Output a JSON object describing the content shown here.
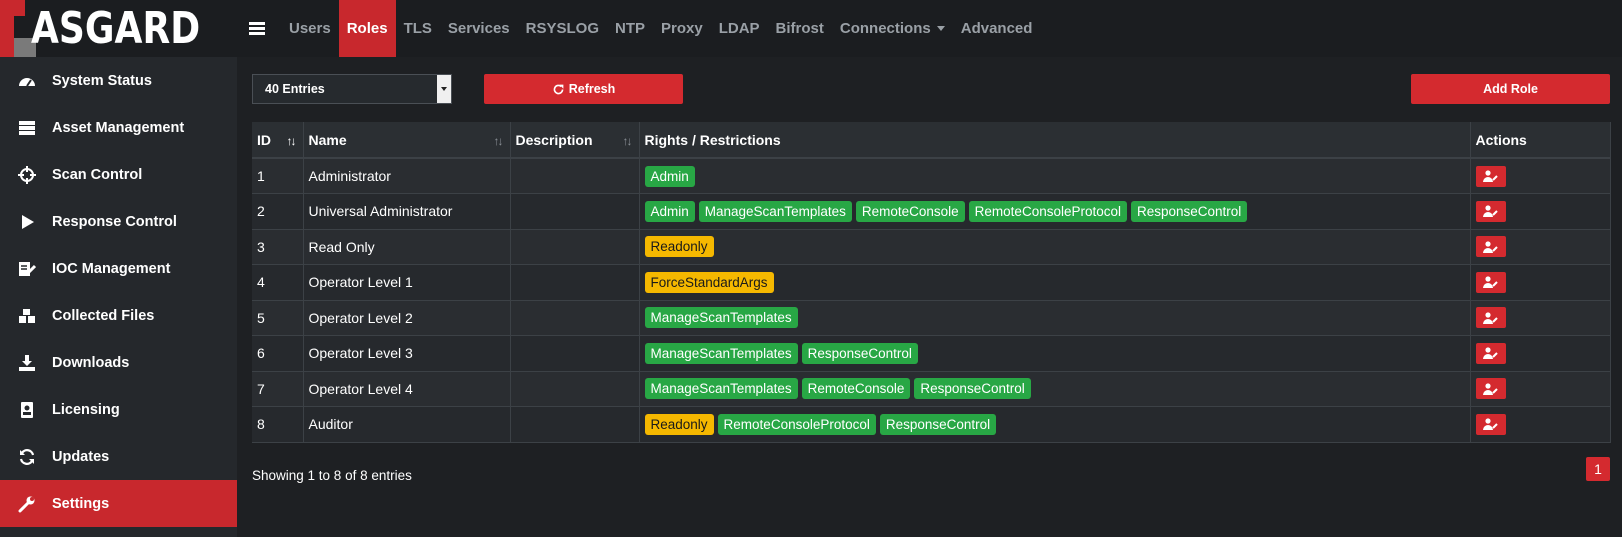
{
  "app": {
    "name": "ASGARD"
  },
  "sidebar": {
    "items": [
      {
        "label": "System Status",
        "icon": "dashboard-icon"
      },
      {
        "label": "Asset Management",
        "icon": "server-icon"
      },
      {
        "label": "Scan Control",
        "icon": "crosshair-icon"
      },
      {
        "label": "Response Control",
        "icon": "play-icon"
      },
      {
        "label": "IOC Management",
        "icon": "edit-document-icon"
      },
      {
        "label": "Collected Files",
        "icon": "boxes-icon"
      },
      {
        "label": "Downloads",
        "icon": "download-icon"
      },
      {
        "label": "Licensing",
        "icon": "id-card-icon"
      },
      {
        "label": "Updates",
        "icon": "sync-icon"
      },
      {
        "label": "Settings",
        "icon": "wrench-icon"
      }
    ],
    "active": "Settings"
  },
  "topnav": {
    "items": [
      "Users",
      "Roles",
      "TLS",
      "Services",
      "RSYSLOG",
      "NTP",
      "Proxy",
      "LDAP",
      "Bifrost",
      "Connections",
      "Advanced"
    ],
    "active": "Roles"
  },
  "controls": {
    "entries_selected": "40 Entries",
    "refresh_label": "Refresh",
    "add_role_label": "Add Role"
  },
  "table": {
    "columns": [
      "ID",
      "Name",
      "Description",
      "Rights / Restrictions",
      "Actions"
    ],
    "rows": [
      {
        "id": "1",
        "name": "Administrator",
        "description": "",
        "rights": [
          {
            "label": "Admin",
            "color": "green"
          }
        ]
      },
      {
        "id": "2",
        "name": "Universal Administrator",
        "description": "",
        "rights": [
          {
            "label": "Admin",
            "color": "green"
          },
          {
            "label": "ManageScanTemplates",
            "color": "green"
          },
          {
            "label": "RemoteConsole",
            "color": "green"
          },
          {
            "label": "RemoteConsoleProtocol",
            "color": "green"
          },
          {
            "label": "ResponseControl",
            "color": "green"
          }
        ]
      },
      {
        "id": "3",
        "name": "Read Only",
        "description": "",
        "rights": [
          {
            "label": "Readonly",
            "color": "yellow"
          }
        ]
      },
      {
        "id": "4",
        "name": "Operator Level 1",
        "description": "",
        "rights": [
          {
            "label": "ForceStandardArgs",
            "color": "yellow"
          }
        ]
      },
      {
        "id": "5",
        "name": "Operator Level 2",
        "description": "",
        "rights": [
          {
            "label": "ManageScanTemplates",
            "color": "green"
          }
        ]
      },
      {
        "id": "6",
        "name": "Operator Level 3",
        "description": "",
        "rights": [
          {
            "label": "ManageScanTemplates",
            "color": "green"
          },
          {
            "label": "ResponseControl",
            "color": "green"
          }
        ]
      },
      {
        "id": "7",
        "name": "Operator Level 4",
        "description": "",
        "rights": [
          {
            "label": "ManageScanTemplates",
            "color": "green"
          },
          {
            "label": "RemoteConsole",
            "color": "green"
          },
          {
            "label": "ResponseControl",
            "color": "green"
          }
        ]
      },
      {
        "id": "8",
        "name": "Auditor",
        "description": "",
        "rights": [
          {
            "label": "Readonly",
            "color": "yellow"
          },
          {
            "label": "RemoteConsoleProtocol",
            "color": "green"
          },
          {
            "label": "ResponseControl",
            "color": "green"
          }
        ]
      }
    ]
  },
  "footer": {
    "showing": "Showing 1 to 8 of 8 entries",
    "page": "1"
  },
  "colors": {
    "accent": "#d42a2f",
    "badge_green": "#28a745",
    "badge_yellow": "#f5b800"
  }
}
